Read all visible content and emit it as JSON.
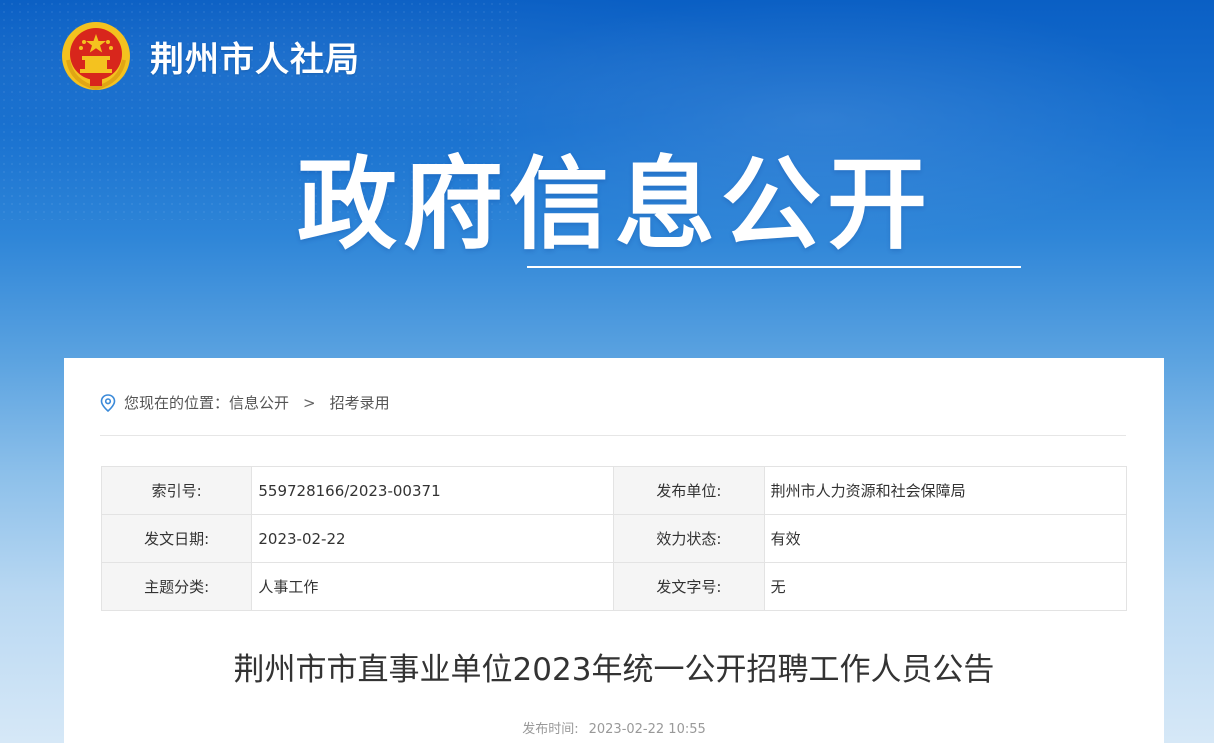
{
  "header": {
    "site_name": "荆州市人社局",
    "emblem_icon": "national-emblem-icon"
  },
  "hero": {
    "title": "政府信息公开"
  },
  "breadcrumb": {
    "prefix": "您现在的位置：",
    "items": [
      "信息公开",
      "招考录用"
    ],
    "separator": ">"
  },
  "meta": {
    "rows": [
      {
        "label1": "索引号:",
        "value1": "559728166/2023-00371",
        "label2": "发布单位:",
        "value2": "荆州市人力资源和社会保障局"
      },
      {
        "label1": "发文日期:",
        "value1": "2023-02-22",
        "label2": "效力状态:",
        "value2": "有效"
      },
      {
        "label1": "主题分类:",
        "value1": "人事工作",
        "label2": "发文字号:",
        "value2": "无"
      }
    ]
  },
  "article": {
    "title": "荆州市市直事业单位2023年统一公开招聘工作人员公告",
    "publish_label": "发布时间:",
    "publish_time": "2023-02-22 10:55"
  },
  "colors": {
    "banner_top": "#0a5fc4",
    "banner_bottom": "#d6e8f7",
    "text_primary": "#333333",
    "emblem_red": "#d8261c",
    "emblem_gold": "#f4c21f",
    "pin_blue": "#3b8ad9"
  }
}
